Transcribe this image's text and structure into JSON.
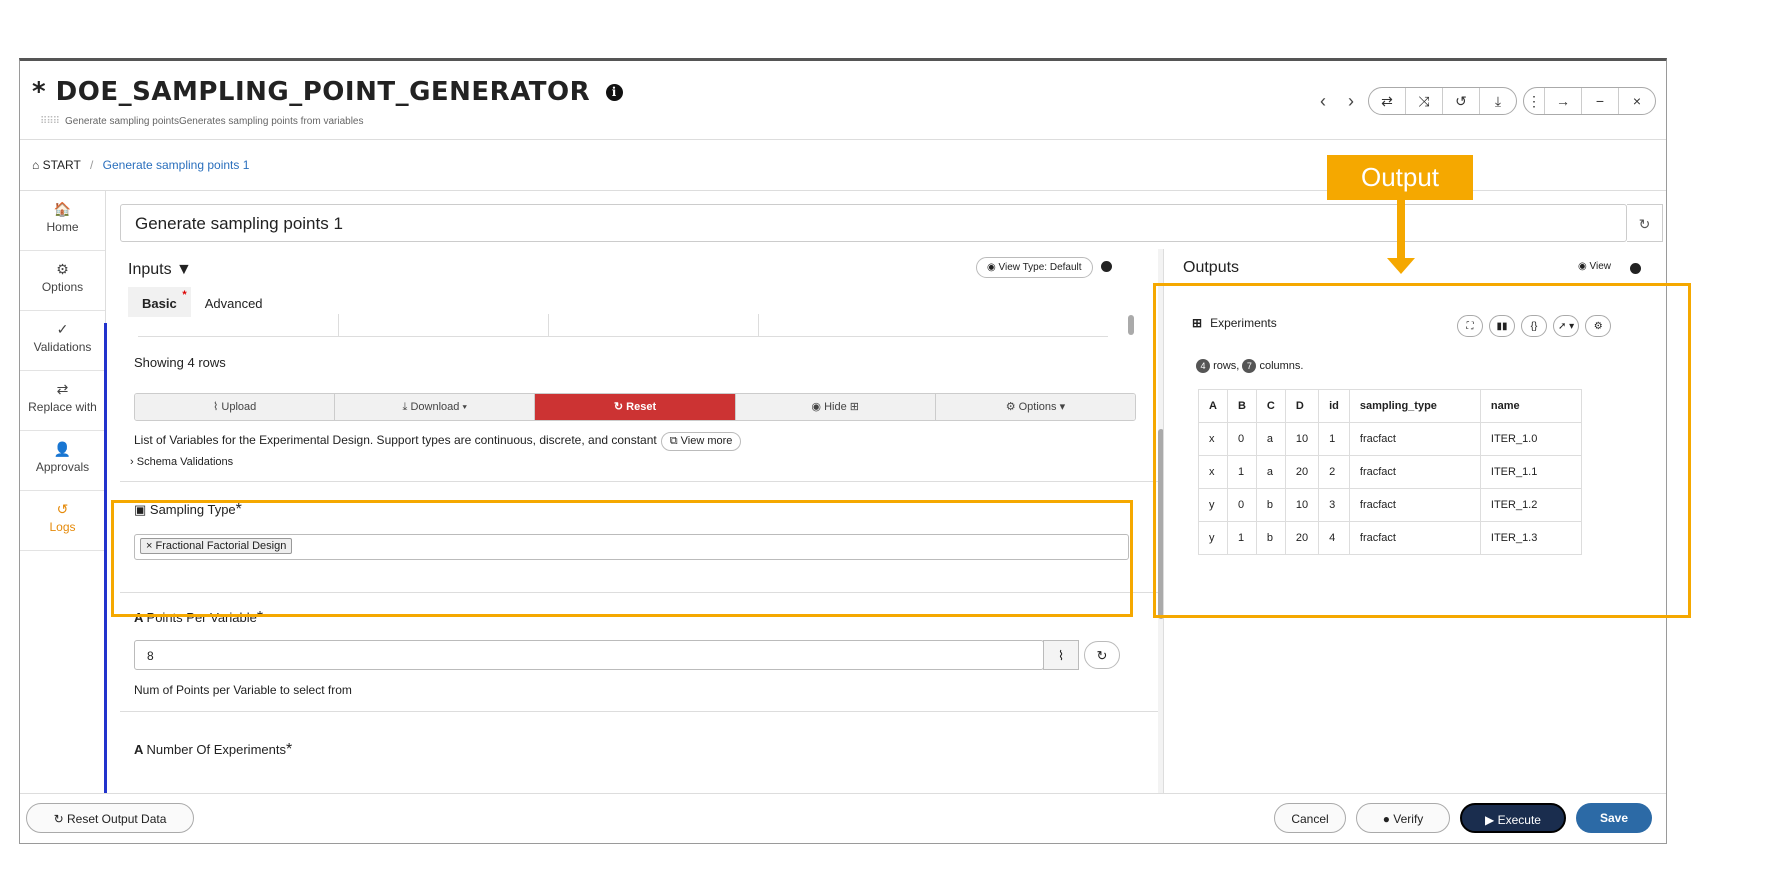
{
  "header": {
    "modified_mark": "*",
    "title": "DOE_SAMPLING_POINT_GENERATOR",
    "info_icon": "info-circle-icon",
    "subtitle": "Generate sampling pointsGenerates sampling points from variables"
  },
  "nav_buttons": [
    "‹",
    "›"
  ],
  "toolbar_icons": [
    "⇄",
    "⤨",
    "↺",
    "⤓",
    "⋮",
    "→",
    "−",
    "×"
  ],
  "breadcrumb": {
    "home": "START",
    "separator": "/",
    "current": "Generate sampling points 1"
  },
  "sidebar": {
    "items": [
      {
        "label": "Home",
        "icon": "home-icon",
        "glyph": "🏠"
      },
      {
        "label": "Options",
        "icon": "gear-icon",
        "glyph": "⚙"
      },
      {
        "label": "Validations",
        "icon": "check-double-icon",
        "glyph": "✓"
      },
      {
        "label": "Replace with",
        "icon": "swap-icon",
        "glyph": "⇄"
      },
      {
        "label": "Approvals",
        "icon": "user-check-icon",
        "glyph": "👤"
      },
      {
        "label": "Logs",
        "icon": "history-icon",
        "glyph": "↺"
      }
    ]
  },
  "name_field": {
    "value": "Generate sampling points 1"
  },
  "inputs": {
    "title": "Inputs",
    "view_type": "View Type: Default",
    "tabs": [
      "Basic",
      "Advanced"
    ],
    "showing": "Showing 4 rows",
    "buttons": [
      "Upload",
      "Download ▾",
      "Reset",
      "Hide ⊞",
      "Options ▾"
    ],
    "list_text": "List of Variables for the Experimental Design. Support types are continuous, discrete, and constant",
    "view_more": "View more",
    "schema": "Schema Validations",
    "sampling_type": {
      "label": "Sampling Type",
      "required": "*",
      "chip": "Fractional Factorial Design"
    },
    "points_per_variable": {
      "label": "Points Per Variable",
      "required": "*",
      "value": "8",
      "help": "Num of Points per Variable to select from"
    },
    "number_of_experiments": {
      "label": "Number Of Experiments",
      "required": "*"
    }
  },
  "outputs": {
    "title": "Outputs",
    "view": "View",
    "experiments_title": "Experiments",
    "rows_count": "4",
    "rows_label": "rows,",
    "cols_count": "7",
    "cols_label": "columns.",
    "tool_icons": [
      "⛶",
      "▮▮",
      "{}",
      "➚ ▾",
      "⚙"
    ],
    "columns": [
      "A",
      "B",
      "C",
      "D",
      "id",
      "sampling_type",
      "name"
    ],
    "rows": [
      [
        "x",
        "0",
        "a",
        "10",
        "1",
        "fracfact",
        "ITER_1.0"
      ],
      [
        "x",
        "1",
        "a",
        "20",
        "2",
        "fracfact",
        "ITER_1.1"
      ],
      [
        "y",
        "0",
        "b",
        "10",
        "3",
        "fracfact",
        "ITER_1.2"
      ],
      [
        "y",
        "1",
        "b",
        "20",
        "4",
        "fracfact",
        "ITER_1.3"
      ]
    ]
  },
  "footer": {
    "reset_output": "Reset Output Data",
    "cancel": "Cancel",
    "verify": "Verify",
    "execute": "Execute",
    "save": "Save"
  },
  "annotation": {
    "label": "Output",
    "color": "#f5a800"
  }
}
